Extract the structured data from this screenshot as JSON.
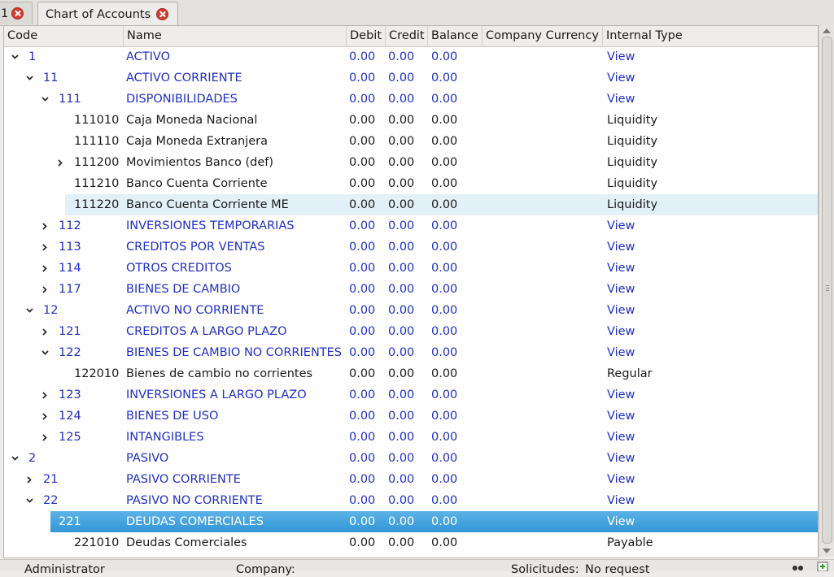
{
  "tabs": [
    {
      "label": "1"
    },
    {
      "label": "Chart of Accounts"
    }
  ],
  "columns": {
    "code": "Code",
    "name": "Name",
    "debit": "Debit",
    "credit": "Credit",
    "balance": "Balance",
    "currency": "Company Currency",
    "type": "Internal Type"
  },
  "rows": [
    {
      "code": "1",
      "name": "ACTIVO",
      "debit": "0.00",
      "credit": "0.00",
      "balance": "0.00",
      "currency": "",
      "type": "View",
      "level": 0,
      "toggle": "expanded",
      "view": true
    },
    {
      "code": "11",
      "name": "ACTIVO CORRIENTE",
      "debit": "0.00",
      "credit": "0.00",
      "balance": "0.00",
      "currency": "",
      "type": "View",
      "level": 1,
      "toggle": "expanded",
      "view": true
    },
    {
      "code": "111",
      "name": "DISPONIBILIDADES",
      "debit": "0.00",
      "credit": "0.00",
      "balance": "0.00",
      "currency": "",
      "type": "View",
      "level": 2,
      "toggle": "expanded",
      "view": true
    },
    {
      "code": "111010",
      "name": "Caja Moneda Nacional",
      "debit": "0.00",
      "credit": "0.00",
      "balance": "0.00",
      "currency": "",
      "type": "Liquidity",
      "level": 3,
      "toggle": "none",
      "view": false
    },
    {
      "code": "111110",
      "name": "Caja Moneda Extranjera",
      "debit": "0.00",
      "credit": "0.00",
      "balance": "0.00",
      "currency": "",
      "type": "Liquidity",
      "level": 3,
      "toggle": "none",
      "view": false
    },
    {
      "code": "111200",
      "name": "Movimientos Banco (def)",
      "debit": "0.00",
      "credit": "0.00",
      "balance": "0.00",
      "currency": "",
      "type": "Liquidity",
      "level": 3,
      "toggle": "collapsed",
      "view": false
    },
    {
      "code": "111210",
      "name": "Banco Cuenta Corriente",
      "debit": "0.00",
      "credit": "0.00",
      "balance": "0.00",
      "currency": "",
      "type": "Liquidity",
      "level": 3,
      "toggle": "none",
      "view": false
    },
    {
      "code": "111220",
      "name": "Banco Cuenta Corriente ME",
      "debit": "0.00",
      "credit": "0.00",
      "balance": "0.00",
      "currency": "",
      "type": "Liquidity",
      "level": 3,
      "toggle": "none",
      "view": false,
      "hover": true
    },
    {
      "code": "112",
      "name": "INVERSIONES TEMPORARIAS",
      "debit": "0.00",
      "credit": "0.00",
      "balance": "0.00",
      "currency": "",
      "type": "View",
      "level": 2,
      "toggle": "collapsed",
      "view": true
    },
    {
      "code": "113",
      "name": "CREDITOS POR VENTAS",
      "debit": "0.00",
      "credit": "0.00",
      "balance": "0.00",
      "currency": "",
      "type": "View",
      "level": 2,
      "toggle": "collapsed",
      "view": true
    },
    {
      "code": "114",
      "name": "OTROS CREDITOS",
      "debit": "0.00",
      "credit": "0.00",
      "balance": "0.00",
      "currency": "",
      "type": "View",
      "level": 2,
      "toggle": "collapsed",
      "view": true
    },
    {
      "code": "117",
      "name": "BIENES DE CAMBIO",
      "debit": "0.00",
      "credit": "0.00",
      "balance": "0.00",
      "currency": "",
      "type": "View",
      "level": 2,
      "toggle": "collapsed",
      "view": true
    },
    {
      "code": "12",
      "name": "ACTIVO NO CORRIENTE",
      "debit": "0.00",
      "credit": "0.00",
      "balance": "0.00",
      "currency": "",
      "type": "View",
      "level": 1,
      "toggle": "expanded",
      "view": true
    },
    {
      "code": "121",
      "name": "CREDITOS A LARGO PLAZO",
      "debit": "0.00",
      "credit": "0.00",
      "balance": "0.00",
      "currency": "",
      "type": "View",
      "level": 2,
      "toggle": "collapsed",
      "view": true
    },
    {
      "code": "122",
      "name": "BIENES DE CAMBIO NO CORRIENTES",
      "debit": "0.00",
      "credit": "0.00",
      "balance": "0.00",
      "currency": "",
      "type": "View",
      "level": 2,
      "toggle": "expanded",
      "view": true
    },
    {
      "code": "122010",
      "name": "Bienes de cambio no corrientes",
      "debit": "0.00",
      "credit": "0.00",
      "balance": "0.00",
      "currency": "",
      "type": "Regular",
      "level": 3,
      "toggle": "none",
      "view": false
    },
    {
      "code": "123",
      "name": "INVERSIONES A LARGO PLAZO",
      "debit": "0.00",
      "credit": "0.00",
      "balance": "0.00",
      "currency": "",
      "type": "View",
      "level": 2,
      "toggle": "collapsed",
      "view": true
    },
    {
      "code": "124",
      "name": "BIENES DE USO",
      "debit": "0.00",
      "credit": "0.00",
      "balance": "0.00",
      "currency": "",
      "type": "View",
      "level": 2,
      "toggle": "collapsed",
      "view": true
    },
    {
      "code": "125",
      "name": "INTANGIBLES",
      "debit": "0.00",
      "credit": "0.00",
      "balance": "0.00",
      "currency": "",
      "type": "View",
      "level": 2,
      "toggle": "collapsed",
      "view": true
    },
    {
      "code": "2",
      "name": "PASIVO",
      "debit": "0.00",
      "credit": "0.00",
      "balance": "0.00",
      "currency": "",
      "type": "View",
      "level": 0,
      "toggle": "expanded",
      "view": true
    },
    {
      "code": "21",
      "name": "PASIVO CORRIENTE",
      "debit": "0.00",
      "credit": "0.00",
      "balance": "0.00",
      "currency": "",
      "type": "View",
      "level": 1,
      "toggle": "collapsed",
      "view": true
    },
    {
      "code": "22",
      "name": "PASIVO NO CORRIENTE",
      "debit": "0.00",
      "credit": "0.00",
      "balance": "0.00",
      "currency": "",
      "type": "View",
      "level": 1,
      "toggle": "expanded",
      "view": true
    },
    {
      "code": "221",
      "name": "DEUDAS COMERCIALES",
      "debit": "0.00",
      "credit": "0.00",
      "balance": "0.00",
      "currency": "",
      "type": "View",
      "level": 2,
      "toggle": "expanded",
      "view": true,
      "selected": true
    },
    {
      "code": "221010",
      "name": "Deudas Comerciales",
      "debit": "0.00",
      "credit": "0.00",
      "balance": "0.00",
      "currency": "",
      "type": "Payable",
      "level": 3,
      "toggle": "none",
      "view": false
    }
  ],
  "statusbar": {
    "user": "Administrator",
    "company_label": "Company:",
    "requests_label": "Solicitudes:",
    "requests_value": "No request"
  },
  "colors": {
    "view_text": "#1f2fc4",
    "selection": "#3296d8",
    "hover": "#e2f0f8"
  }
}
